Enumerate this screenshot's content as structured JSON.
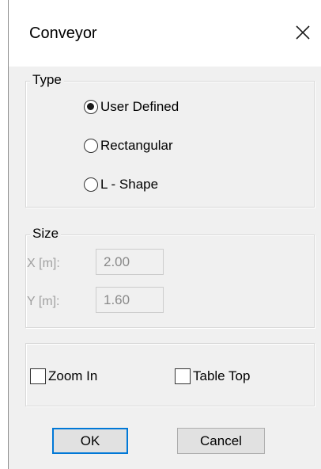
{
  "window": {
    "title": "Conveyor"
  },
  "type_group": {
    "legend": "Type",
    "options": [
      {
        "label": "User Defined",
        "checked": true
      },
      {
        "label": "Rectangular",
        "checked": false
      },
      {
        "label": "L - Shape",
        "checked": false
      }
    ]
  },
  "size_group": {
    "legend": "Size",
    "x_label": "X [m]:",
    "x_value": "2.00",
    "y_label": "Y [m]:",
    "y_value": "1.60"
  },
  "options_group": {
    "zoom_in_label": "Zoom In",
    "zoom_in_checked": false,
    "table_top_label": "Table Top",
    "table_top_checked": false
  },
  "buttons": {
    "ok_label": "OK",
    "cancel_label": "Cancel"
  },
  "colors": {
    "accent": "#0078d7",
    "dialog_bg": "#f0f0f0",
    "disabled_text": "#a0a0a0"
  },
  "icons": {
    "close": "close-icon"
  }
}
